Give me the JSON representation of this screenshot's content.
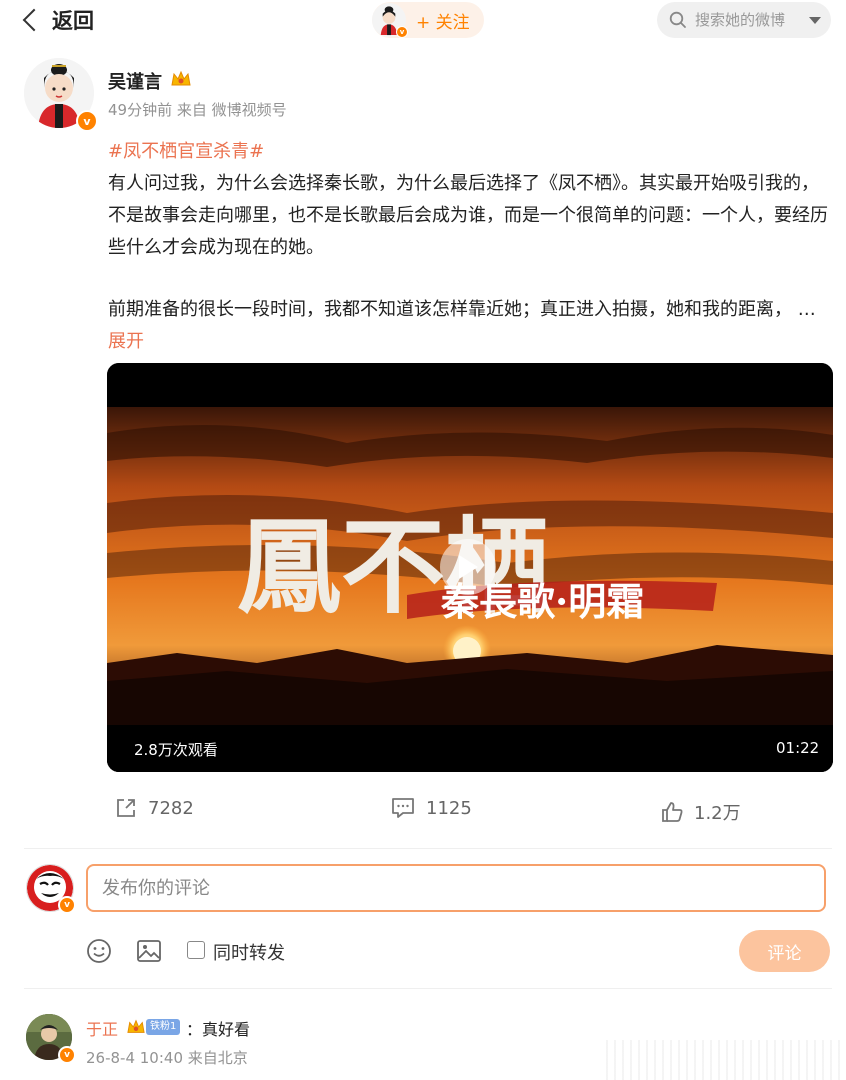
{
  "nav": {
    "back_label": "返回",
    "follow_label": "+ 关注",
    "search_placeholder": "搜索她的微博"
  },
  "post": {
    "author_name": "吴谨言",
    "time": "49分钟前",
    "source": "来自 微博视频号",
    "hashtag": "#凤不栖官宣杀青#",
    "paragraph1": "有人问过我，为什么会选择秦长歌，为什么最后选择了《凤不栖》。其实最开始吸引我的，不是故事会走向哪里，也不是长歌最后会成为谁，而是一个很简单的问题：一个人，要经历些什么才会成为现在的她。",
    "paragraph2": "前期准备的很长一段时间，我都不知道该怎样靠近她；真正进入拍摄，她和我的距离，",
    "ellipsis": " … ",
    "expand_label": "展开"
  },
  "video": {
    "title": "鳳不栖",
    "subtitle": "秦長歌·明霜",
    "views": "2.8万次观看",
    "duration": "01:22"
  },
  "actions": {
    "repost_count": "7282",
    "comment_count": "1125",
    "like_count": "1.2万"
  },
  "compose": {
    "placeholder": "发布你的评论",
    "repost_label": "同时转发",
    "submit_label": "评论"
  },
  "comment": {
    "name": "于正",
    "fan_badge": "铁粉1",
    "text": "：真好看",
    "meta": "26-8-4 10:40 来自北京"
  },
  "colors": {
    "accent": "#ff8200",
    "link": "#eb7350",
    "submit_disabled": "#fcc49e"
  }
}
